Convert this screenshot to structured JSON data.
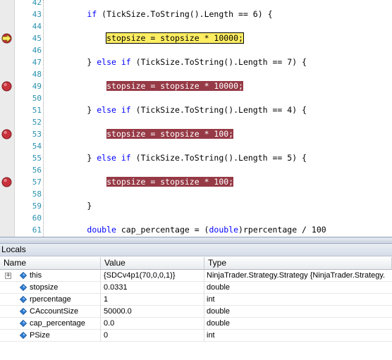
{
  "editor": {
    "lines": [
      {
        "num": "42",
        "tokens": [],
        "marker": null
      },
      {
        "num": "43",
        "tokens": [
          {
            "t": "        ",
            "c": ""
          },
          {
            "t": "if",
            "c": "kw"
          },
          {
            "t": " (TickSize.ToString().Length == 6) {",
            "c": ""
          }
        ],
        "marker": null
      },
      {
        "num": "44",
        "tokens": [],
        "marker": null
      },
      {
        "num": "45",
        "tokens": [
          {
            "t": "            ",
            "c": ""
          },
          {
            "t": "stopsize = stopsize * 10000;",
            "c": "hl-current"
          }
        ],
        "marker": "current"
      },
      {
        "num": "46",
        "tokens": [],
        "marker": null
      },
      {
        "num": "47",
        "tokens": [
          {
            "t": "        } ",
            "c": ""
          },
          {
            "t": "else if",
            "c": "kw"
          },
          {
            "t": " (TickSize.ToString().Length == 7) {",
            "c": ""
          }
        ],
        "marker": null
      },
      {
        "num": "48",
        "tokens": [],
        "marker": null
      },
      {
        "num": "49",
        "tokens": [
          {
            "t": "            ",
            "c": ""
          },
          {
            "t": "stopsize = stopsize * 10000;",
            "c": "hl-bp"
          }
        ],
        "marker": "breakpoint"
      },
      {
        "num": "50",
        "tokens": [],
        "marker": null
      },
      {
        "num": "51",
        "tokens": [
          {
            "t": "        } ",
            "c": ""
          },
          {
            "t": "else if",
            "c": "kw"
          },
          {
            "t": " (TickSize.ToString().Length == 4) {",
            "c": ""
          }
        ],
        "marker": null
      },
      {
        "num": "52",
        "tokens": [],
        "marker": null
      },
      {
        "num": "53",
        "tokens": [
          {
            "t": "            ",
            "c": ""
          },
          {
            "t": "stopsize = stopsize * 100;",
            "c": "hl-bp"
          }
        ],
        "marker": "breakpoint"
      },
      {
        "num": "54",
        "tokens": [],
        "marker": null
      },
      {
        "num": "55",
        "tokens": [
          {
            "t": "        } ",
            "c": ""
          },
          {
            "t": "else if",
            "c": "kw"
          },
          {
            "t": " (TickSize.ToString().Length == 5) {",
            "c": ""
          }
        ],
        "marker": null
      },
      {
        "num": "56",
        "tokens": [],
        "marker": null
      },
      {
        "num": "57",
        "tokens": [
          {
            "t": "            ",
            "c": ""
          },
          {
            "t": "stopsize = stopsize * 100;",
            "c": "hl-bp"
          }
        ],
        "marker": "breakpoint"
      },
      {
        "num": "58",
        "tokens": [],
        "marker": null
      },
      {
        "num": "59",
        "tokens": [
          {
            "t": "        }",
            "c": ""
          }
        ],
        "marker": null
      },
      {
        "num": "60",
        "tokens": [],
        "marker": null
      },
      {
        "num": "61",
        "tokens": [
          {
            "t": "        ",
            "c": ""
          },
          {
            "t": "double",
            "c": "kw"
          },
          {
            "t": " cap_percentage = (",
            "c": ""
          },
          {
            "t": "double",
            "c": "kw"
          },
          {
            "t": ")rpercentage / 100",
            "c": ""
          }
        ],
        "marker": null
      }
    ],
    "colors": {
      "current_line": "#ffee62",
      "breakpoint_line": "#963a46",
      "breakpoint_dot": "#c8323c",
      "keyword": "#0000ff",
      "line_number": "#2b91af"
    }
  },
  "locals": {
    "title": "Locals",
    "columns": {
      "name": "Name",
      "value": "Value",
      "type": "Type"
    },
    "rows": [
      {
        "name": "this",
        "value": "{SDCv4p1(70,0,0,1)}",
        "type": "NinjaTrader.Strategy.Strategy {NinjaTrader.Strategy.",
        "expandable": true,
        "icon": "field-icon"
      },
      {
        "name": "stopsize",
        "value": "0.0331",
        "type": "double",
        "expandable": false,
        "icon": "field-icon"
      },
      {
        "name": "rpercentage",
        "value": "1",
        "type": "int",
        "expandable": false,
        "icon": "field-icon"
      },
      {
        "name": "CAccountSize",
        "value": "50000.0",
        "type": "double",
        "expandable": false,
        "icon": "field-icon"
      },
      {
        "name": "cap_percentage",
        "value": "0.0",
        "type": "double",
        "expandable": false,
        "icon": "field-icon"
      },
      {
        "name": "PSize",
        "value": "0",
        "type": "int",
        "expandable": false,
        "icon": "field-icon"
      }
    ],
    "expander_glyph": "+"
  }
}
